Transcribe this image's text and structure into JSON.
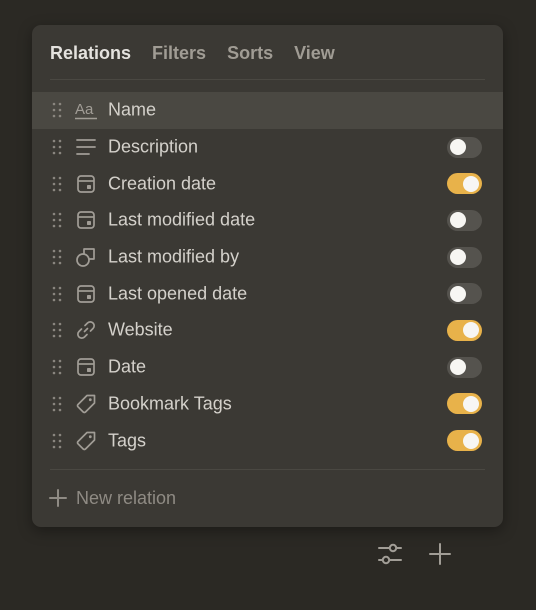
{
  "tabs": [
    {
      "label": "Relations",
      "active": true
    },
    {
      "label": "Filters",
      "active": false
    },
    {
      "label": "Sorts",
      "active": false
    },
    {
      "label": "View",
      "active": false
    }
  ],
  "relations": [
    {
      "label": "Name",
      "icon": "text-icon",
      "toggle": null,
      "highlighted": true
    },
    {
      "label": "Description",
      "icon": "lines-icon",
      "toggle": false
    },
    {
      "label": "Creation date",
      "icon": "calendar-icon",
      "toggle": true
    },
    {
      "label": "Last modified date",
      "icon": "calendar-icon",
      "toggle": false
    },
    {
      "label": "Last modified by",
      "icon": "object-icon",
      "toggle": false
    },
    {
      "label": "Last opened date",
      "icon": "calendar-icon",
      "toggle": false
    },
    {
      "label": "Website",
      "icon": "link-icon",
      "toggle": true
    },
    {
      "label": "Date",
      "icon": "calendar-icon",
      "toggle": false
    },
    {
      "label": "Bookmark Tags",
      "icon": "tag-icon",
      "toggle": true
    },
    {
      "label": "Tags",
      "icon": "tag-icon",
      "toggle": true
    }
  ],
  "new_relation_label": "New relation",
  "footer_buttons": [
    "settings-sliders-icon",
    "plus-icon"
  ],
  "colors": {
    "toggle_on": "#e8b24a",
    "toggle_off": "#55534e",
    "panel_bg": "#3b3934",
    "page_bg": "#2b2924"
  }
}
